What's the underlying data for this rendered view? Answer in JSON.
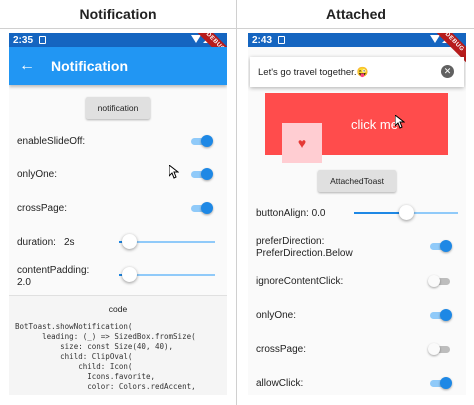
{
  "columns": {
    "left_title": "Notification",
    "right_title": "Attached"
  },
  "left": {
    "status_time": "2:35",
    "debug_label": "DEBUG",
    "appbar_title": "Notification",
    "notification_button": "notification",
    "options": [
      {
        "label": "enableSlideOff:",
        "on": true
      },
      {
        "label": "onlyOne:",
        "on": true
      },
      {
        "label": "crossPage:",
        "on": true
      }
    ],
    "duration_label": "duration:",
    "duration_value": "2s",
    "duration_slider": 0.1,
    "padding_label_line1": "contentPadding:",
    "padding_label_line2": "2.0",
    "padding_slider": 0.1,
    "code_title": "code",
    "code_text": "BotToast.showNotification(\n      leading: (_) => SizedBox.fromSize(\n          size: const Size(40, 40),\n          child: ClipOval(\n              child: Icon(\n                Icons.favorite,\n                color: Colors.redAccent,"
  },
  "right": {
    "status_time": "2:43",
    "debug_label": "DEBUG",
    "toast_text": "Let's go travel together.😜",
    "close_icon": "close-icon",
    "click_me": "click me",
    "attached_button": "AttachedToast",
    "button_align_label": "buttonAlign: 0.0",
    "button_align_slider": 0.5,
    "prefer_line1": "preferDirection:",
    "prefer_line2": "PreferDirection.Below",
    "options": [
      {
        "label": "ignoreContentClick:",
        "on": false
      },
      {
        "label": "onlyOne:",
        "on": true
      },
      {
        "label": "crossPage:",
        "on": false
      },
      {
        "label": "allowClick:",
        "on": true
      }
    ],
    "prefer_on": true
  },
  "colors": {
    "primary": "#2196f3",
    "switch_on": "#1e88e5",
    "red_box": "#ff4c4c",
    "status_bar": "#1565c0"
  }
}
